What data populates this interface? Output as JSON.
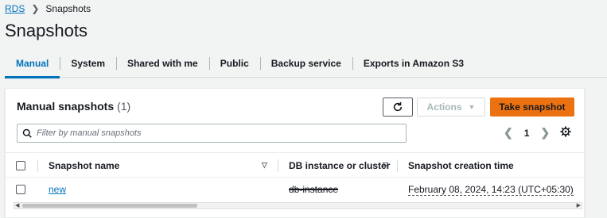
{
  "breadcrumb": {
    "parent": "RDS",
    "current": "Snapshots"
  },
  "page": {
    "title": "Snapshots"
  },
  "tabs": [
    {
      "label": "Manual"
    },
    {
      "label": "System"
    },
    {
      "label": "Shared with me"
    },
    {
      "label": "Public"
    },
    {
      "label": "Backup service"
    },
    {
      "label": "Exports in Amazon S3"
    }
  ],
  "panel": {
    "title": "Manual snapshots",
    "count": "(1)",
    "actions_label": "Actions",
    "take_snapshot_label": "Take snapshot",
    "search_placeholder": "Filter by manual snapshots",
    "page_number": "1"
  },
  "table": {
    "columns": [
      "Snapshot name",
      "DB instance or cluster",
      "Snapshot creation time"
    ],
    "rows": [
      {
        "name": "new",
        "instance": "db-instance",
        "created": "February 08, 2024, 14:23 (UTC+05:30)"
      }
    ]
  },
  "colors": {
    "accent": "#0073bb",
    "primary_button": "#ec7211",
    "page_bg": "#f2f3f3"
  }
}
